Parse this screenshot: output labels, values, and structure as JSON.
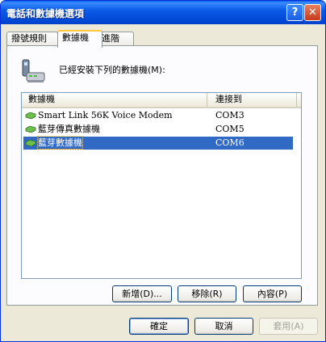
{
  "window": {
    "title": "電話和數據機選項"
  },
  "titlebar": {
    "help_label": "?",
    "close_label": "✕"
  },
  "tabs": [
    {
      "label": "撥號規則"
    },
    {
      "label": "數據機"
    },
    {
      "label": "進階"
    }
  ],
  "main": {
    "installed_label": "已經安裝下列的數據機(M):",
    "columns": {
      "modem": "數據機",
      "attached_to": "連接到"
    },
    "rows": [
      {
        "name": "Smart Link 56K Voice Modem",
        "port": "COM3"
      },
      {
        "name": "藍芽傳真數據機",
        "port": "COM5"
      },
      {
        "name": "藍芽數據機",
        "port": "COM6"
      }
    ],
    "buttons": {
      "add": "新增(D)...",
      "remove": "移除(R)",
      "properties": "內容(P)"
    }
  },
  "footer": {
    "ok": "確定",
    "cancel": "取消",
    "apply": "套用(A)"
  },
  "colors": {
    "titlebar": "#0058e6",
    "selection": "#316ac5",
    "dialog_bg": "#ece9d8"
  }
}
